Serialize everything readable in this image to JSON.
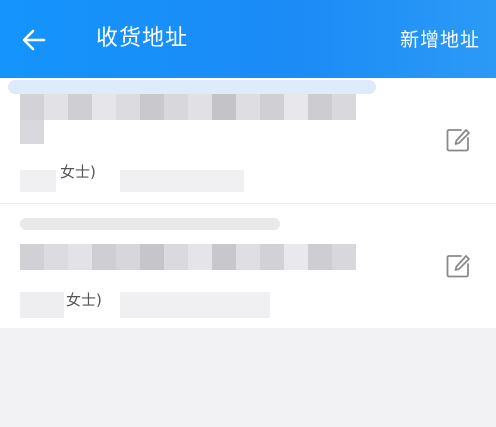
{
  "header": {
    "title": "收货地址",
    "add_label": "新增地址"
  },
  "addresses": [
    {
      "name_suffix": "女士)"
    },
    {
      "name_suffix": "女士)"
    }
  ],
  "colors": {
    "header": "#1c8bf6",
    "text_white": "#ffffff",
    "icon": "#8a8a8a"
  },
  "icons": {
    "back": "arrow-left-icon",
    "edit": "edit-pencil-icon"
  }
}
